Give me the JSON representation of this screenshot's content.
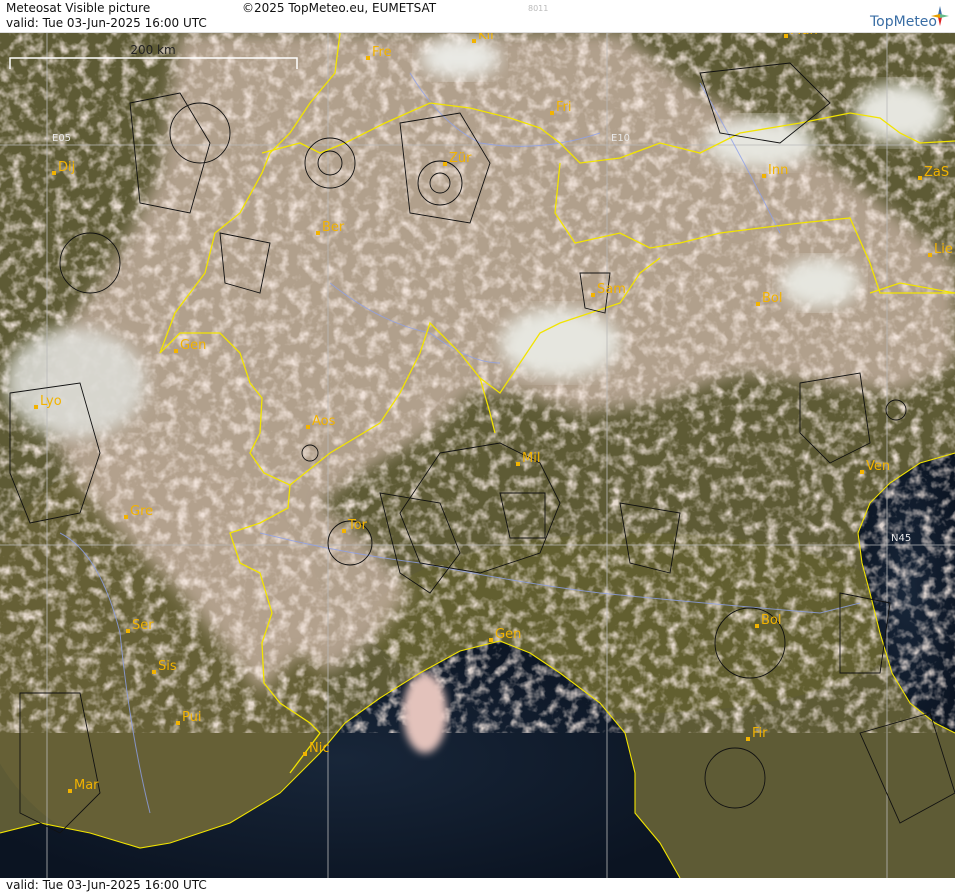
{
  "header": {
    "title": "Meteosat Visible picture",
    "copyright": "©2025 TopMeteo.eu, EUMETSAT",
    "code": "8011",
    "valid_line": "valid:  Tue  03-Jun-2025  16:00 UTC",
    "brand": "TopMeteo"
  },
  "footer": {
    "valid_line": "valid:  Tue  03-Jun-2025  16:00 UTC"
  },
  "scale": {
    "label": "200 km"
  },
  "grid": {
    "lon_labels": [
      "E05",
      "E10"
    ],
    "lat_labels": [
      "N45"
    ]
  },
  "cities": [
    "Kli",
    "Mun",
    "Fre",
    "Fri",
    "Dij",
    "Zür",
    "Inn",
    "ZaS",
    "Ber",
    "Lie",
    "Sam",
    "Bol",
    "Gen",
    "Lyo",
    "Aos",
    "Mil",
    "Ven",
    "Gre",
    "Tor",
    "Ser",
    "Bol",
    "Gen",
    "Sis",
    "Pui",
    "Nic",
    "Fir",
    "Mar"
  ],
  "colors": {
    "land": "#5d5a34",
    "sea": "#0f1b2c",
    "border": "#f2e400",
    "city": "#f2b300",
    "airspace": "#111111",
    "river": "#8fa0e8",
    "cloud": "#e9ccc0"
  }
}
